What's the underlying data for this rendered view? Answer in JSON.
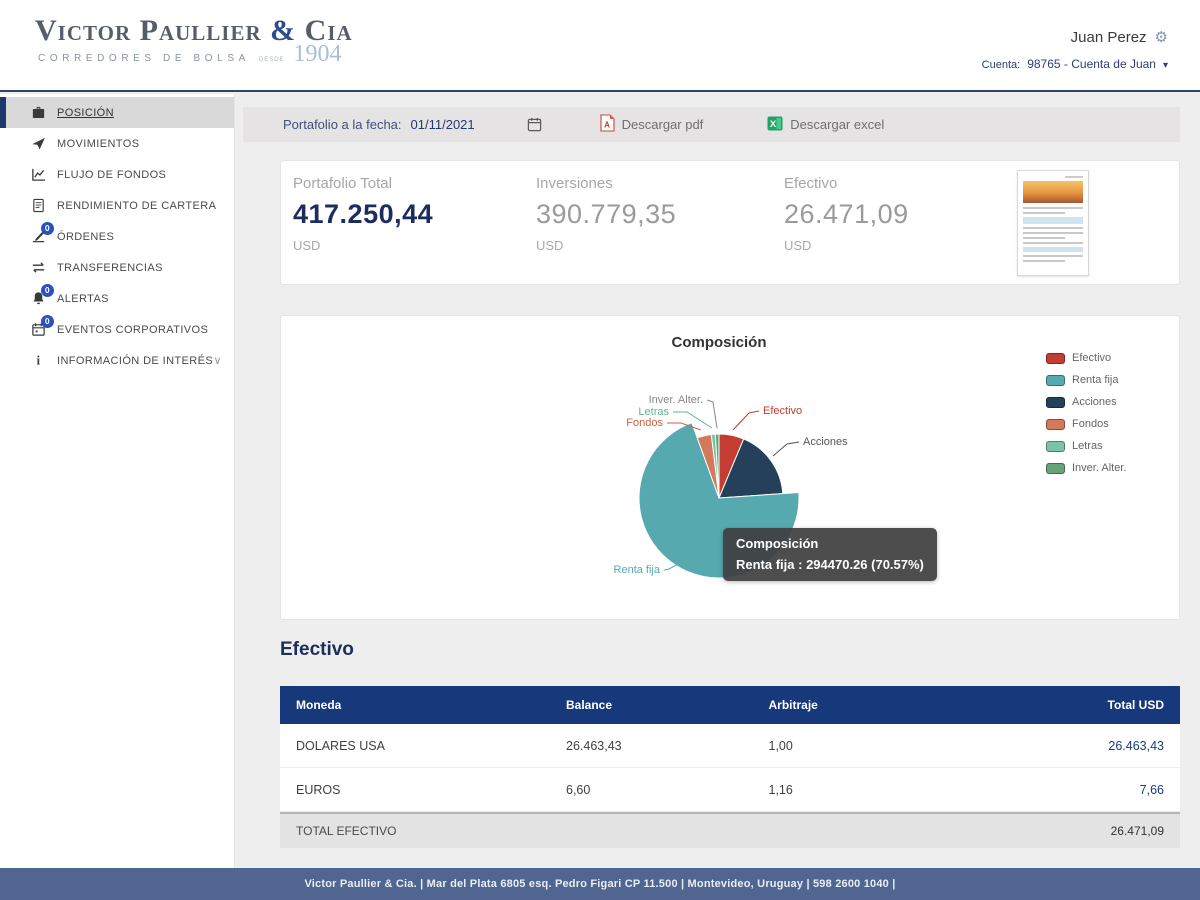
{
  "header": {
    "logo": {
      "name_a": "Victor Paullier ",
      "amp": "&",
      "name_b": " Cia",
      "subtitle": "CORREDORES DE BOLSA",
      "desde": "DESDE",
      "year": "1904"
    },
    "user_name": "Juan Perez",
    "account_label": "Cuenta:",
    "account_value": "98765 - Cuenta de Juan"
  },
  "sidebar": {
    "items": [
      {
        "label": "POSICIÓN",
        "icon": "portfolio-icon",
        "active": true
      },
      {
        "label": "MOVIMIENTOS",
        "icon": "send-icon"
      },
      {
        "label": "FLUJO DE FONDOS",
        "icon": "chart-icon"
      },
      {
        "label": "RENDIMIENTO DE CARTERA",
        "icon": "report-icon"
      },
      {
        "label": "ÓRDENES",
        "icon": "orders-icon",
        "badge": "0"
      },
      {
        "label": "TRANSFERENCIAS",
        "icon": "transfer-icon"
      },
      {
        "label": "ALERTAS",
        "icon": "bell-icon",
        "badge": "0"
      },
      {
        "label": "EVENTOS CORPORATIVOS",
        "icon": "calendar-icon",
        "badge": "0"
      },
      {
        "label": "INFORMACIÓN DE INTERÉS",
        "icon": "info-icon",
        "chevron": true
      }
    ]
  },
  "toolbar": {
    "date_label": "Portafolio a la fecha:",
    "date_value": "01/11/2021",
    "pdf_label": "Descargar pdf",
    "excel_label": "Descargar excel"
  },
  "summary": {
    "cards": [
      {
        "label": "Portafolio Total",
        "value": "417.250,44",
        "currency": "USD",
        "emphasis": true
      },
      {
        "label": "Inversiones",
        "value": "390.779,35",
        "currency": "USD",
        "emphasis": false
      },
      {
        "label": "Efectivo",
        "value": "26.471,09",
        "currency": "USD",
        "emphasis": false
      }
    ]
  },
  "chart_data": {
    "type": "pie",
    "title": "Composición",
    "slices": [
      {
        "label": "Efectivo",
        "pct": 6.3,
        "color": "#c43d33",
        "label_color": "#c43d33"
      },
      {
        "label": "Acciones",
        "pct": 17.6,
        "color": "#24405a",
        "label_color": "#555555"
      },
      {
        "label": "Renta fija",
        "pct": 70.57,
        "value": 294470.26,
        "color": "#57a9b0",
        "label_color": "#57a9b0",
        "hovered": true
      },
      {
        "label": "Fondos",
        "pct": 3.6,
        "color": "#d5795b",
        "label_color": "#cc6242"
      },
      {
        "label": "Letras",
        "pct": 1.0,
        "color": "#79c4a5",
        "label_color": "#5fb391"
      },
      {
        "label": "Inver. Alter.",
        "pct": 0.93,
        "color": "#68a378",
        "label_color": "#888888"
      }
    ],
    "legend": [
      {
        "label": "Efectivo",
        "color": "#c43d33"
      },
      {
        "label": "Renta fija",
        "color": "#57a9b0"
      },
      {
        "label": "Acciones",
        "color": "#24405a"
      },
      {
        "label": "Fondos",
        "color": "#d5795b"
      },
      {
        "label": "Letras",
        "color": "#79c4a5"
      },
      {
        "label": "Inver. Alter.",
        "color": "#68a378"
      }
    ],
    "legend_position": "right",
    "tooltip": {
      "title": "Composición",
      "line": "Renta fija : 294470.26 (70.57%)"
    }
  },
  "efectivo_table": {
    "title": "Efectivo",
    "columns": [
      "Moneda",
      "Balance",
      "Arbitraje",
      "Total USD"
    ],
    "rows": [
      [
        "DOLARES USA",
        "26.463,43",
        "1,00",
        "26.463,43"
      ],
      [
        "EUROS",
        "6,60",
        "1,16",
        "7,66"
      ]
    ],
    "total_label": "TOTAL EFECTIVO",
    "total_value": "26.471,09"
  },
  "footer": {
    "text": "Victor Paullier & Cia. | Mar del Plata 6805 esq. Pedro Figari CP 11.500 | Montevideo, Uruguay | 598 2600 1040 |"
  },
  "colors": {
    "brand_navy": "#1c2f5c",
    "table_header_bg": "#17387b",
    "footer_bg": "#50658f",
    "badge_blue": "#2a52be",
    "page_bg": "#efeeee"
  }
}
